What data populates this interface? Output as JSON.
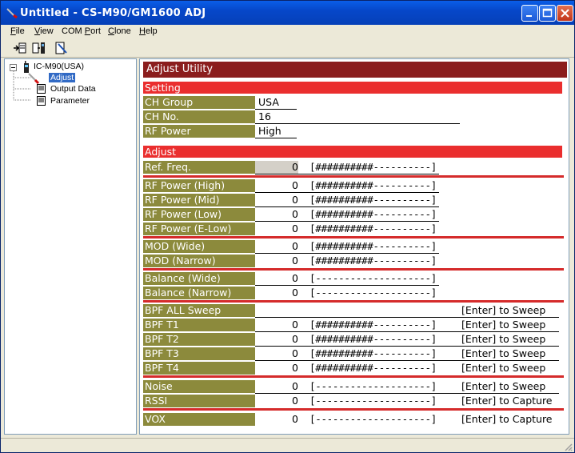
{
  "window": {
    "title": "Untitled - CS-M90/GM1600 ADJ"
  },
  "menu": [
    {
      "label": "File",
      "u": "F",
      "rest": "ile"
    },
    {
      "label": "View",
      "u": "V",
      "rest": "iew"
    },
    {
      "label": "COM Port",
      "pre": "COM ",
      "u": "P",
      "rest": "ort"
    },
    {
      "label": "Clone",
      "u": "C",
      "rest": "lone"
    },
    {
      "label": "Help",
      "u": "H",
      "rest": "elp"
    }
  ],
  "tree": {
    "root": "IC-M90(USA)",
    "items": [
      "Adjust",
      "Output Data",
      "Parameter"
    ],
    "selected": "Adjust"
  },
  "panel": {
    "title": "Adjust Utility",
    "setting_header": "Setting",
    "settings": [
      {
        "label": "CH Group",
        "value": "USA"
      },
      {
        "label": "CH No.",
        "value": "16"
      },
      {
        "label": "RF Power",
        "value": "High"
      }
    ],
    "adjust_header": "Adjust",
    "rows": [
      {
        "label": "Ref. Freq.",
        "value": "0",
        "bar": "[##########----------]",
        "action": ""
      },
      {
        "label": "RF Power (High)",
        "value": "0",
        "bar": "[##########----------]",
        "action": ""
      },
      {
        "label": "RF Power (Mid)",
        "value": "0",
        "bar": "[##########----------]",
        "action": ""
      },
      {
        "label": "RF Power (Low)",
        "value": "0",
        "bar": "[##########----------]",
        "action": ""
      },
      {
        "label": "RF Power (E-Low)",
        "value": "0",
        "bar": "[##########----------]",
        "action": ""
      },
      {
        "label": "MOD (Wide)",
        "value": "0",
        "bar": "[##########----------]",
        "action": ""
      },
      {
        "label": "MOD (Narrow)",
        "value": "0",
        "bar": "[##########----------]",
        "action": ""
      },
      {
        "label": "Balance (Wide)",
        "value": "0",
        "bar": "[--------------------]",
        "action": ""
      },
      {
        "label": "Balance (Narrow)",
        "value": "0",
        "bar": "[--------------------]",
        "action": ""
      },
      {
        "label": "BPF ALL Sweep",
        "value": "",
        "bar": "",
        "action": "[Enter] to Sweep"
      },
      {
        "label": "BPF T1",
        "value": "0",
        "bar": "[##########----------]",
        "action": "[Enter] to Sweep"
      },
      {
        "label": "BPF T2",
        "value": "0",
        "bar": "[##########----------]",
        "action": "[Enter] to Sweep"
      },
      {
        "label": "BPF T3",
        "value": "0",
        "bar": "[##########----------]",
        "action": "[Enter] to Sweep"
      },
      {
        "label": "BPF T4",
        "value": "0",
        "bar": "[##########----------]",
        "action": "[Enter] to Sweep"
      },
      {
        "label": "Noise",
        "value": "0",
        "bar": "[--------------------]",
        "action": "[Enter] to Sweep"
      },
      {
        "label": "RSSI",
        "value": "0",
        "bar": "[--------------------]",
        "action": "[Enter] to Capture"
      },
      {
        "label": "VOX",
        "value": "0",
        "bar": "[--------------------]",
        "action": "[Enter] to Capture"
      }
    ]
  },
  "colors": {
    "header": "#8b1d1d",
    "section": "#ea2e2e",
    "label_bg": "#8c8a3c"
  }
}
